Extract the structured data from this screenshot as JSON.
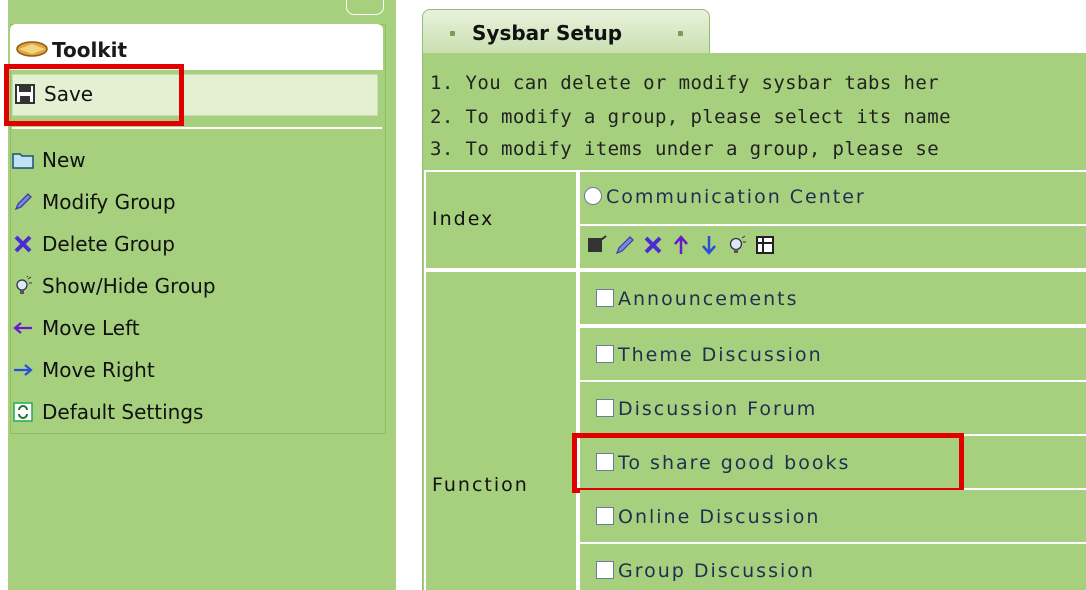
{
  "toolkit": {
    "title": "Toolkit",
    "save_label": "Save",
    "items": [
      {
        "label": "New",
        "icon": "folder-icon"
      },
      {
        "label": "Modify Group",
        "icon": "pencil-icon"
      },
      {
        "label": "Delete Group",
        "icon": "delete-x-icon"
      },
      {
        "label": "Show/Hide Group",
        "icon": "lightbulb-icon"
      },
      {
        "label": "Move Left",
        "icon": "arrow-left-icon"
      },
      {
        "label": "Move Right",
        "icon": "arrow-right-icon"
      },
      {
        "label": "Default Settings",
        "icon": "refresh-icon"
      }
    ]
  },
  "tab": {
    "label": "Sysbar Setup"
  },
  "instructions": [
    "1. You can delete or modify sysbar tabs her",
    "2. To modify a group, please select its name",
    "3. To modify items under a group, please se"
  ],
  "index": {
    "label": "Index",
    "group_name": "Communication Center"
  },
  "function": {
    "label": "Function",
    "items": [
      "Announcements",
      "Theme Discussion",
      "Discussion Forum",
      "To share good books",
      "Online Discussion",
      "Group Discussion"
    ]
  },
  "colors": {
    "panel": "#a6d07e",
    "highlight": "#e00000"
  }
}
